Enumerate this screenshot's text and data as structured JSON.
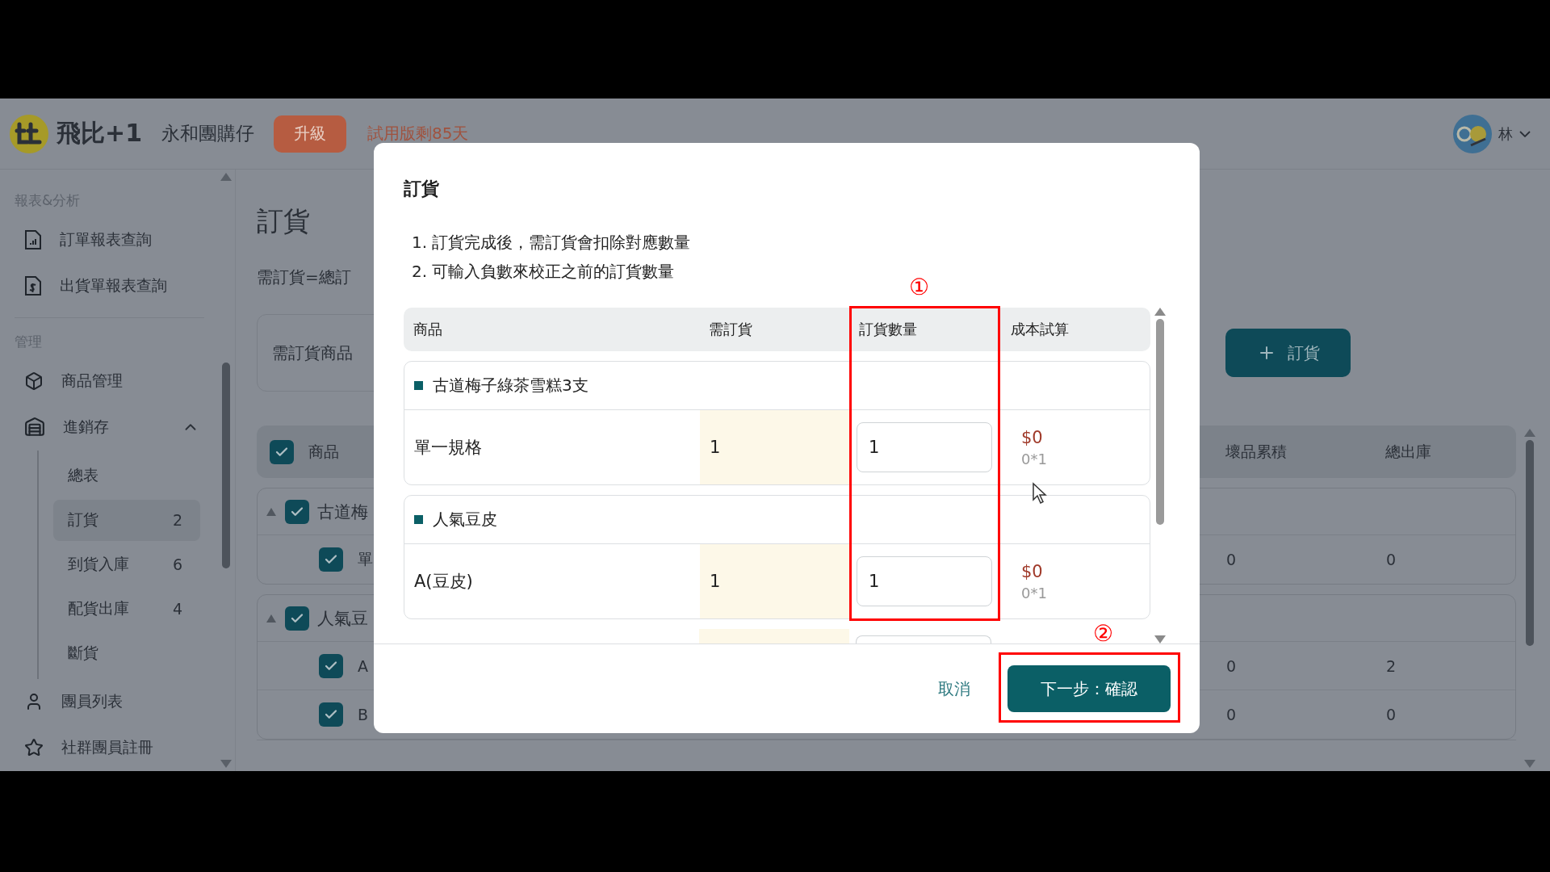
{
  "header": {
    "logo_text": "飛比+1",
    "store_name": "永和團購仔",
    "upgrade_button": "升級",
    "trial_notice": "試用版剩85天",
    "user_name": "林"
  },
  "sidebar": {
    "sections": [
      {
        "title": "報表&分析",
        "items": [
          {
            "label": "訂單報表查詢"
          },
          {
            "label": "出貨單報表查詢"
          }
        ]
      },
      {
        "title": "管理",
        "items": [
          {
            "label": "商品管理"
          },
          {
            "label": "進銷存",
            "expanded": true,
            "children": [
              {
                "label": "總表",
                "selected": false
              },
              {
                "label": "訂貨",
                "selected": true,
                "count": "2"
              },
              {
                "label": "到貨入庫",
                "selected": false,
                "count": "6"
              },
              {
                "label": "配貨出庫",
                "selected": false,
                "count": "4"
              },
              {
                "label": "斷貨",
                "selected": false
              }
            ]
          },
          {
            "label": "團員列表"
          },
          {
            "label": "社群團員註冊"
          }
        ]
      }
    ]
  },
  "main": {
    "title": "訂貨",
    "formula": "需訂貨=總訂",
    "filter": "需訂貨商品",
    "add_button": "訂貨",
    "table": {
      "select_all": true,
      "columns": [
        "商品",
        "壞品累積",
        "總出庫"
      ],
      "groups": [
        {
          "name": "古道梅",
          "expanded": true,
          "checked": true,
          "variants": [
            {
              "name": "單",
              "checked": true,
              "damaged": "0",
              "shipped": "0"
            }
          ]
        },
        {
          "name": "人氣豆",
          "expanded": true,
          "checked": true,
          "variants": [
            {
              "name": "A",
              "checked": true,
              "damaged": "0",
              "shipped": "2"
            },
            {
              "name": "B",
              "checked": true,
              "damaged": "0",
              "shipped": "0"
            }
          ]
        }
      ]
    }
  },
  "dialog": {
    "title": "訂貨",
    "notes": [
      "1. 訂貨完成後，需訂貨會扣除對應數量",
      "2. 可輸入負數來校正之前的訂貨數量"
    ],
    "columns": [
      "商品",
      "需訂貨",
      "訂貨數量",
      "成本試算"
    ],
    "groups": [
      {
        "name": "古道梅子綠茶雪糕3支",
        "rows": [
          {
            "spec": "單一規格",
            "need": "1",
            "qty": "1",
            "cost": "$0",
            "formula": "0*1"
          }
        ]
      },
      {
        "name": "人氣豆皮",
        "rows": [
          {
            "spec": "A(豆皮)",
            "need": "1",
            "qty": "1",
            "cost": "$0",
            "formula": "0*1"
          }
        ]
      }
    ],
    "cancel_button": "取消",
    "confirm_button": "下一步：確認",
    "annotations": [
      {
        "label": "①"
      },
      {
        "label": "②"
      }
    ]
  }
}
